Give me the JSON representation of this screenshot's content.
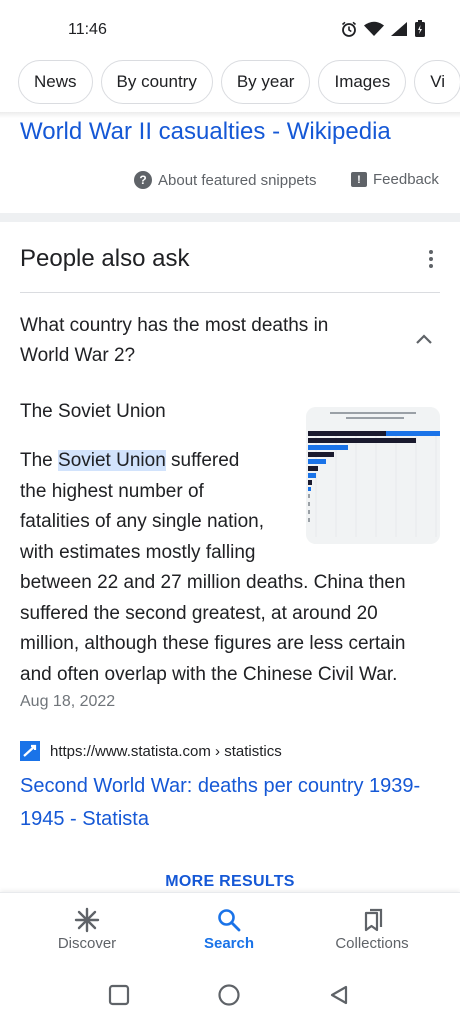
{
  "status_bar": {
    "time": "11:46",
    "icons": [
      "alarm-icon",
      "wifi-icon",
      "signal-icon",
      "battery-icon"
    ]
  },
  "chips": [
    "News",
    "By country",
    "By year",
    "Images",
    "Vi"
  ],
  "featured": {
    "title": "World War II casualties - Wikipedia",
    "about_label": "About featured snippets",
    "feedback_label": "Feedback"
  },
  "paa": {
    "heading": "People also ask",
    "question": "What country has the most deaths in World War 2?",
    "short_answer": "The Soviet Union",
    "body_prefix": "The ",
    "highlight": "Soviet Union",
    "body_line1_rest": " suffered",
    "body_lines": [
      "the highest number of",
      "fatalities of any single nation,",
      "with estimates mostly falling",
      "between 22 and 27 million deaths. China then",
      "suffered the second greatest, at around 20",
      "million, although these figures are less certain",
      "and often overlap with the Chinese Civil War."
    ],
    "date": "Aug 18, 2022",
    "source_url": "https://www.statista.com › statistics",
    "result_title": "Second World War: deaths per country 1939-1945 - Statista"
  },
  "more_results": "MORE RESULTS",
  "bottom_nav": [
    {
      "label": "Discover",
      "icon": "asterisk-icon",
      "active": false
    },
    {
      "label": "Search",
      "icon": "search-icon",
      "active": true
    },
    {
      "label": "Collections",
      "icon": "collections-icon",
      "active": false
    }
  ],
  "system_nav": [
    "recents-square-icon",
    "home-circle-icon",
    "back-triangle-icon"
  ],
  "colors": {
    "link": "#1558d6",
    "accent": "#1a73e8",
    "highlight": "#d2e3fc",
    "muted": "#5f6368"
  }
}
